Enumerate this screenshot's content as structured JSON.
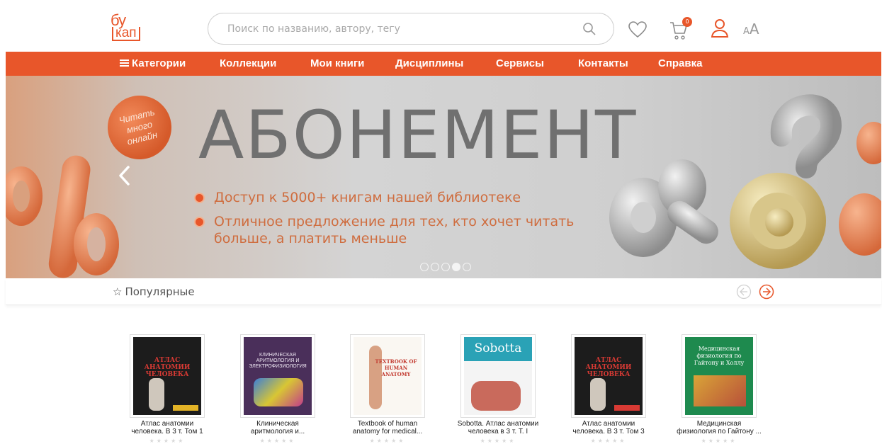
{
  "logo": {
    "top": "бу",
    "bottom": "кап"
  },
  "search": {
    "placeholder": "Поиск по названию, автору, тегу"
  },
  "cart": {
    "count": "0"
  },
  "font_toggle": {
    "small": "A",
    "big": "A"
  },
  "nav": {
    "items": [
      {
        "label": "Категории"
      },
      {
        "label": "Коллекции"
      },
      {
        "label": "Мои книги"
      },
      {
        "label": "Дисциплины"
      },
      {
        "label": "Сервисы"
      },
      {
        "label": "Контакты"
      },
      {
        "label": "Справка"
      }
    ]
  },
  "banner": {
    "title": "АБОНЕМЕНТ",
    "stamp": [
      "Читать",
      "много",
      "онлайн"
    ],
    "bullets": [
      "Доступ к 5000+ книгам нашей библиотеке",
      "Отличное предложение для тех, кто хочет читать больше, а платить меньше"
    ],
    "slides_total": 5,
    "slide_active": 4
  },
  "popular": {
    "title": "Популярные"
  },
  "books": [
    {
      "title_line1": "Атлас анатомии",
      "title_line2": "человека. В 3 т. Том 1",
      "cover_text": "АТЛАС АНАТОМИИ ЧЕЛОВЕКА",
      "rating_stars": "★★★★★"
    },
    {
      "title_line1": "Клиническая",
      "title_line2": "аритмология и...",
      "cover_text": "КЛИНИЧЕСКАЯ АРИТМОЛОГИЯ И ЭЛЕКТРОФИЗИОЛОГИЯ",
      "rating_stars": "★★★★★"
    },
    {
      "title_line1": "Textbook of human",
      "title_line2": "anatomy for medical...",
      "cover_text": "TEXTBOOK OF HUMAN ANATOMY",
      "rating_stars": "★★★★★"
    },
    {
      "title_line1": "Sobotta. Атлас анатомии",
      "title_line2": "человека в 3 т. Т. I",
      "cover_text": "Sobotta",
      "rating_stars": "★★★★★"
    },
    {
      "title_line1": "Атлас анатомии",
      "title_line2": "человека. В 3 т. Том 3",
      "cover_text": "АТЛАС АНАТОМИИ ЧЕЛОВЕКА",
      "rating_stars": "★★★★★"
    },
    {
      "title_line1": "Медицинская",
      "title_line2": "физиология по Гайтону ...",
      "cover_text": "Медицинская физиология по Гайтону и Холлу",
      "rating_stars": "★★★★★"
    }
  ],
  "colors": {
    "accent": "#e8562a",
    "banner_title": "#707070"
  }
}
